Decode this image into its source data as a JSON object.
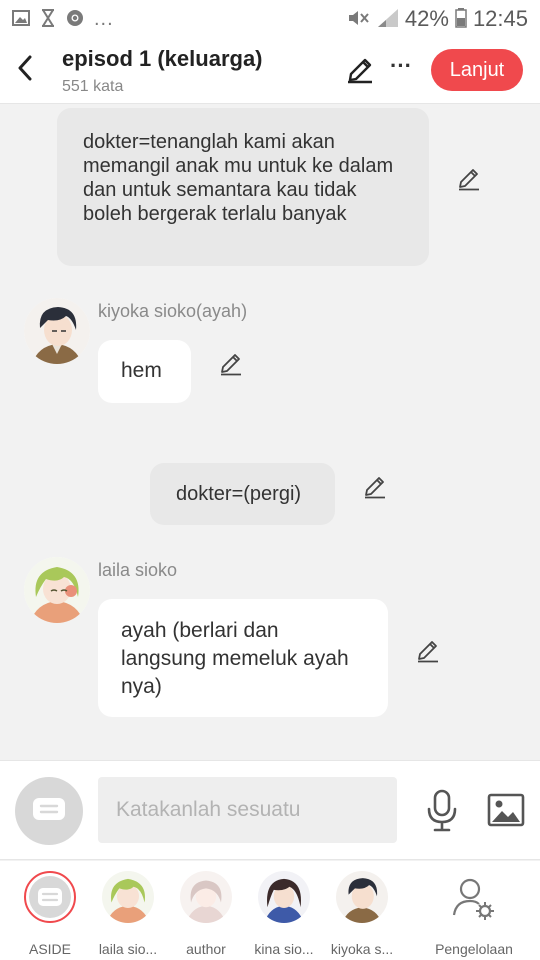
{
  "status_bar": {
    "notification_icons": [
      "image-icon",
      "hourglass-icon",
      "chrome-icon"
    ],
    "overflow_dots": "...",
    "battery_percent": "42%",
    "time": "12:45"
  },
  "header": {
    "title": "episod 1 (keluarga)",
    "subtitle": "551 kata",
    "next_label": "Lanjut",
    "more_label": "···"
  },
  "messages": [
    {
      "type": "narration",
      "text": "dokter=tenanglah kami akan memangil anak mu untuk ke dalam dan untuk semantara kau tidak boleh bergerak terlalu banyak"
    },
    {
      "type": "character",
      "speaker": "kiyoka sioko(ayah)",
      "text": "hem"
    },
    {
      "type": "narration",
      "text": "dokter=(pergi)"
    },
    {
      "type": "character",
      "speaker": "laila sioko",
      "text": "ayah (berlari dan langsung memeluk ayah nya)"
    }
  ],
  "input": {
    "placeholder": "Katakanlah sesuatu"
  },
  "tabs": [
    {
      "label": "ASIDE"
    },
    {
      "label": "laila sio..."
    },
    {
      "label": "author"
    },
    {
      "label": "kina sio..."
    },
    {
      "label": "kiyoka s..."
    },
    {
      "label": "Pengelolaan"
    }
  ],
  "colors": {
    "accent": "#f0494d",
    "background": "#f2f2f2",
    "narration_bubble": "#e8e8e8",
    "character_bubble": "#ffffff"
  }
}
